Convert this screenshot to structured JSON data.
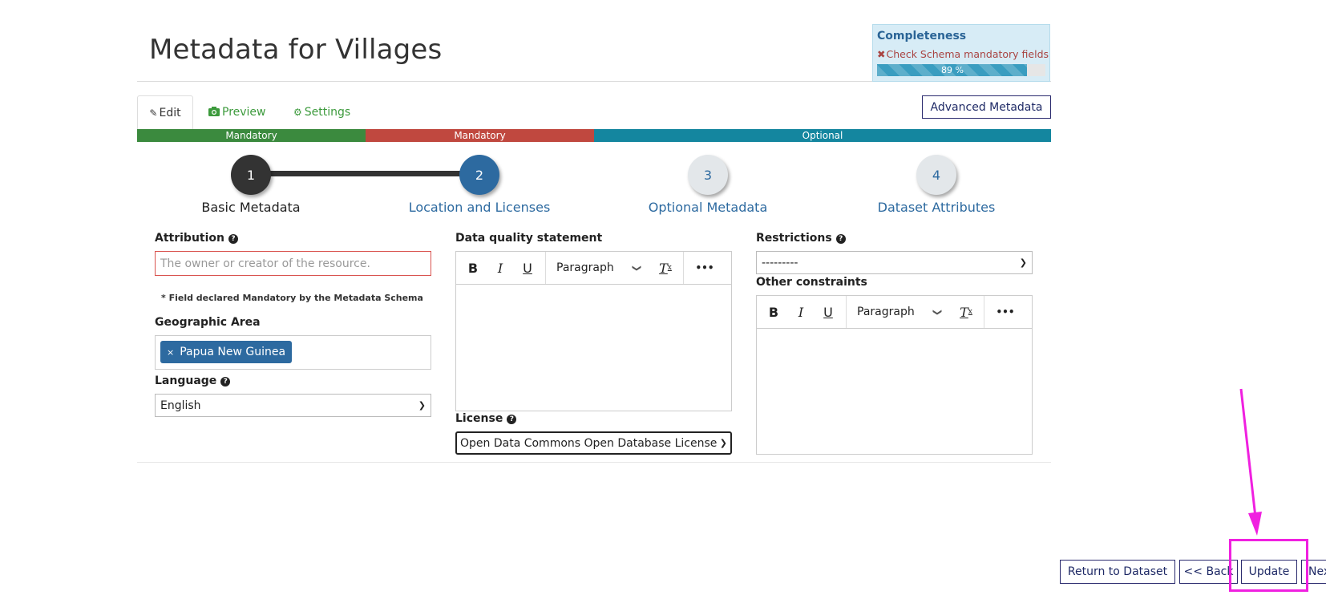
{
  "page": {
    "title": "Metadata for Villages"
  },
  "completeness": {
    "title": "Completeness",
    "check_text": "Check Schema mandatory fields",
    "percent_label": "89 %",
    "progress": 0.89
  },
  "tabs": [
    {
      "label": "Edit",
      "icon": "pencil-icon",
      "active": true
    },
    {
      "label": "Preview",
      "icon": "camera-icon"
    },
    {
      "label": "Settings",
      "icon": "gear-icon"
    }
  ],
  "advanced_button": "Advanced Metadata",
  "sections_bar": [
    {
      "label": "Mandatory",
      "color": "#3b8a3e"
    },
    {
      "label": "Mandatory",
      "color": "#c0483f"
    },
    {
      "label": "Optional",
      "color": "#14869f"
    }
  ],
  "steps": [
    {
      "number": "1",
      "label": "Basic Metadata",
      "state": "done"
    },
    {
      "number": "2",
      "label": "Location and Licenses",
      "state": "current"
    },
    {
      "number": "3",
      "label": "Optional Metadata",
      "state": "upcoming"
    },
    {
      "number": "4",
      "label": "Dataset Attributes",
      "state": "upcoming"
    }
  ],
  "form": {
    "attribution": {
      "label": "Attribution",
      "placeholder": "The owner or creator of the resource."
    },
    "mandatory_note": "* Field declared Mandatory by the Metadata Schema",
    "geographic_area": {
      "label": "Geographic Area",
      "tags": [
        "Papua New Guinea"
      ]
    },
    "language": {
      "label": "Language",
      "value": "English"
    },
    "data_quality": {
      "label": "Data quality statement",
      "format": "Paragraph"
    },
    "license": {
      "label": "License",
      "value": "Open Data Commons Open Database License"
    },
    "restrictions": {
      "label": "Restrictions",
      "value": "---------"
    },
    "other_constraints": {
      "label": "Other constraints",
      "format": "Paragraph"
    }
  },
  "toolbar": {
    "bold": "B",
    "italic": "I",
    "underline": "U",
    "clear_format": "T",
    "more": "•••"
  },
  "footer_buttons": {
    "return": "Return to Dataset",
    "back": "<< Back",
    "update": "Update",
    "next": "Next >>"
  },
  "annotation": {
    "color": "#f020e0"
  }
}
